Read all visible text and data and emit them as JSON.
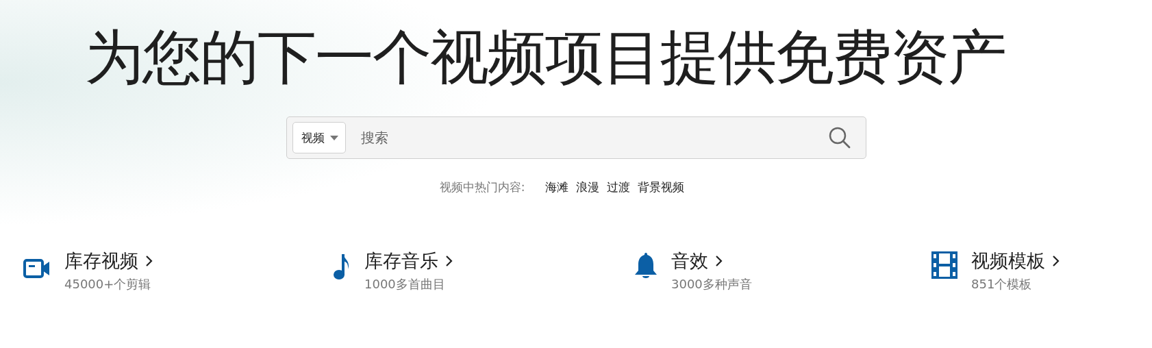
{
  "headline": "为您的下一个视频项目提供免费资产",
  "search": {
    "type_select": "视频",
    "placeholder": "搜索"
  },
  "trending": {
    "label": "视频中热门内容:",
    "tags": [
      "海滩",
      "浪漫",
      "过渡",
      "背景视频"
    ]
  },
  "categories": [
    {
      "kind": "video",
      "title": "库存视频",
      "subtitle": "45000+个剪辑"
    },
    {
      "kind": "music",
      "title": "库存音乐",
      "subtitle": "1000多首曲目"
    },
    {
      "kind": "sound",
      "title": "音效",
      "subtitle": "3000多种声音"
    },
    {
      "kind": "template",
      "title": "视频模板",
      "subtitle": "851个模板"
    }
  ]
}
